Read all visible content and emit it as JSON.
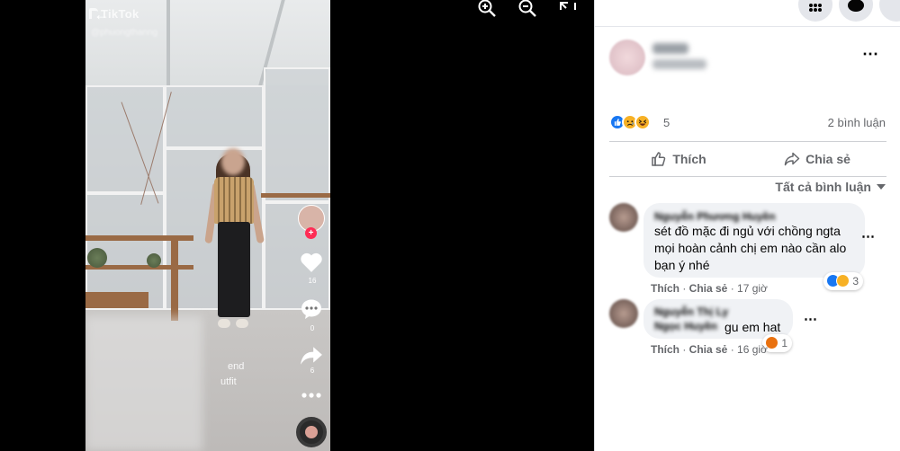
{
  "viewer": {
    "tiktok_brand": "TikTok",
    "tiktok_handle": "@phuongthanng",
    "caption_fragments": [
      "end",
      "utfit"
    ],
    "side_actions": {
      "like_count": "16",
      "comment_count": "0",
      "share_count": "6"
    },
    "controls": [
      "zoom-in-icon",
      "zoom-out-icon",
      "fullscreen-icon"
    ]
  },
  "post": {
    "reaction_count": "5",
    "comment_count": "2 bình luận",
    "actions": {
      "like_label": "Thích",
      "share_label": "Chia sẻ"
    },
    "sort_label": "Tất cả bình luận"
  },
  "comments": [
    {
      "author": "Nguyễn Phương Huyền",
      "text_lines": [
        "sét đồ mặc đi ngủ với chồng ngta",
        "mọi hoàn cảnh chị em nào cần alo",
        "bạn ý nhé"
      ],
      "like_label": "Thích",
      "share_label": "Chia sẻ",
      "time": "17 giờ",
      "reaction_count": "3"
    },
    {
      "author": "Nguyễn Thị Ly",
      "author_line2": "Ngọc Huyền",
      "text": "gu em hat",
      "like_label": "Thích",
      "share_label": "Chia sẻ",
      "time": "16 giờ",
      "reaction_count": "1"
    }
  ],
  "colors": {
    "fb_blue": "#1877f2",
    "haha_yellow": "#f7b125",
    "angry_orange": "#e9710f",
    "tiktok_red": "#fe2c55",
    "meta_gray": "#65676b",
    "bubble_bg": "#f0f2f5"
  }
}
